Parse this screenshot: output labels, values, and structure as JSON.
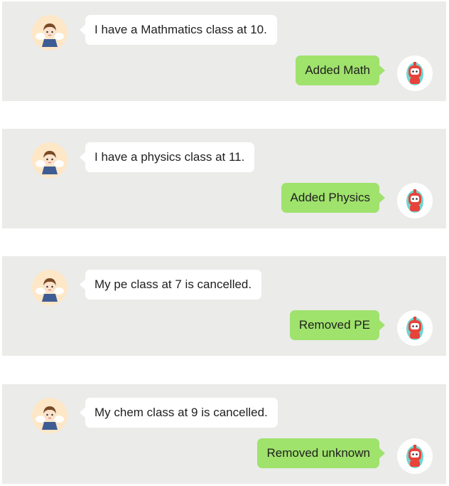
{
  "colors": {
    "panel_background": "#ebebea",
    "incoming_bubble": "#ffffff",
    "outgoing_bubble": "#9fe26c",
    "text": "#1f1f1f"
  },
  "conversation": [
    {
      "user_message": "I have a Mathmatics class at 10.",
      "bot_reply": "Added Math",
      "user_avatar_icon": "boy-angel-avatar-icon",
      "bot_avatar_icon": "red-robot-avatar-icon"
    },
    {
      "user_message": "I have a physics class at 11.",
      "bot_reply": "Added Physics",
      "user_avatar_icon": "boy-angel-avatar-icon",
      "bot_avatar_icon": "red-robot-avatar-icon"
    },
    {
      "user_message": "My pe class at 7 is cancelled.",
      "bot_reply": "Removed PE",
      "user_avatar_icon": "boy-angel-avatar-icon",
      "bot_avatar_icon": "red-robot-avatar-icon"
    },
    {
      "user_message": "My chem class at 9 is cancelled.",
      "bot_reply": "Removed unknown",
      "user_avatar_icon": "boy-angel-avatar-icon",
      "bot_avatar_icon": "red-robot-avatar-icon"
    }
  ]
}
